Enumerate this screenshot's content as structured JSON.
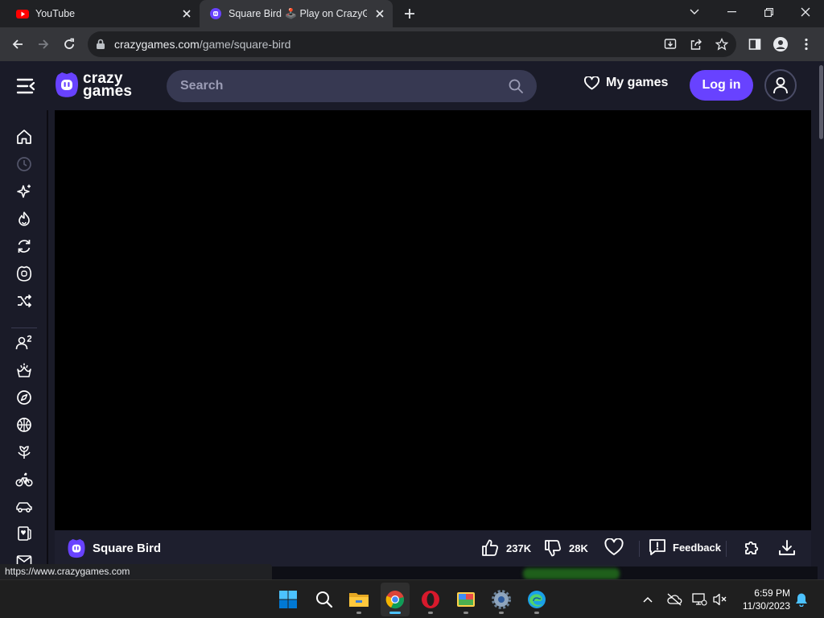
{
  "browser": {
    "tabs": [
      {
        "title": "YouTube",
        "active": false
      },
      {
        "title": "Square Bird 🕹️ Play on CrazyGames",
        "active": true
      }
    ],
    "url_host": "crazygames.com",
    "url_path": "/game/square-bird",
    "status_url": "https://www.crazygames.com"
  },
  "header": {
    "logo_line1": "crazy",
    "logo_line2": "games",
    "search_placeholder": "Search",
    "my_games_label": "My games",
    "login_label": "Log in"
  },
  "sidebar": {
    "items": [
      "home-icon",
      "clock-icon",
      "sparkle-icon",
      "fire-icon",
      "refresh-icon",
      "crazy-logo-icon",
      "shuffle-icon",
      "multiplayer-icon",
      "crown-icon",
      "compass-icon",
      "basketball-icon",
      "flower-icon",
      "bike-icon",
      "car-icon",
      "cards-icon",
      "mail-icon"
    ]
  },
  "game": {
    "title": "Square Bird",
    "likes": "237K",
    "dislikes": "28K",
    "feedback_label": "Feedback"
  },
  "taskbar": {
    "time": "6:59 PM",
    "date": "11/30/2023"
  },
  "colors": {
    "accent": "#6842ff",
    "header_bg": "#1a1b28",
    "search_bg": "#373952"
  }
}
